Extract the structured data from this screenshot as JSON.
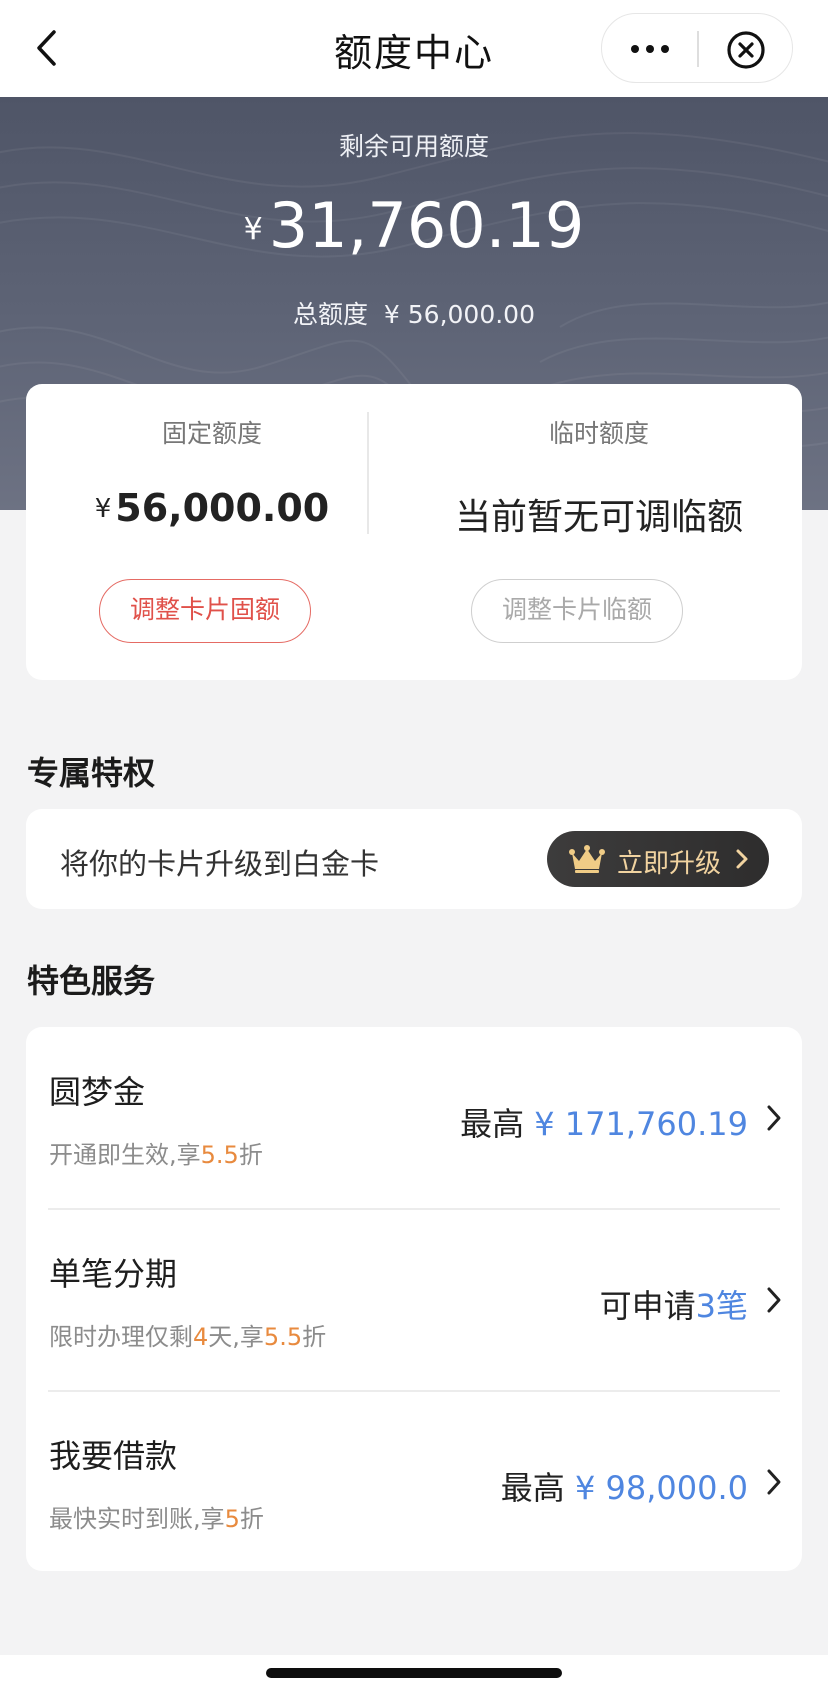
{
  "nav": {
    "title": "额度中心"
  },
  "hero": {
    "label": "剩余可用额度",
    "currency": "¥",
    "amount": "31,760.19",
    "total_label": "总额度",
    "total_value": "¥ 56,000.00"
  },
  "quota": {
    "fixed_label": "固定额度",
    "fixed_currency": "¥",
    "fixed_value": "56,000.00",
    "temp_label": "临时额度",
    "temp_value": "当前暂无可调临额",
    "fixed_button": "调整卡片固额",
    "temp_button": "调整卡片临额"
  },
  "privilege": {
    "section_title": "专属特权",
    "text": "将你的卡片升级到白金卡",
    "button_label": "立即升级"
  },
  "services": {
    "section_title": "特色服务",
    "items": [
      {
        "title": "圆梦金",
        "sub_a": "开通即生效,享",
        "sub_hl1": "5.5",
        "sub_b": "折",
        "right_prefix": "最高 ",
        "right_value": "¥ 171,760.19"
      },
      {
        "title": "单笔分期",
        "sub_a": "限时办理仅剩",
        "sub_hl1": "4",
        "sub_b": "天,享",
        "sub_hl2": "5.5",
        "sub_c": "折",
        "right_prefix": "可申请",
        "right_value": "3笔"
      },
      {
        "title": "我要借款",
        "sub_a": "最快实时到账,享",
        "sub_hl1": "5",
        "sub_b": "折",
        "right_prefix": "最高 ",
        "right_value": "¥ 98,000.0"
      }
    ]
  },
  "colors": {
    "accent_red": "#e0514a",
    "highlight_orange": "#e88a3e",
    "link_blue": "#4f86e0",
    "gold": "#f1d3a0"
  }
}
